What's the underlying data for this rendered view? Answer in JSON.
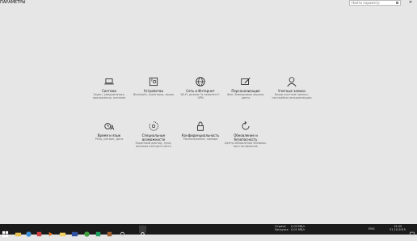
{
  "window": {
    "title": "Параметры",
    "close_glyph": "✕"
  },
  "search": {
    "placeholder": "Найти параметр"
  },
  "tiles": [
    {
      "icon": "laptop-icon",
      "name": "Система",
      "desc": "Экран, уведомления, приложения, питание"
    },
    {
      "icon": "devices-icon",
      "name": "Устройства",
      "desc": "Bluetooth, принтеры, мышь"
    },
    {
      "icon": "globe-icon",
      "name": "Сеть и Интернет",
      "desc": "Wi-Fi, режим \"в самолете\", VPN"
    },
    {
      "icon": "personalization-icon",
      "name": "Персонализация",
      "desc": "Фон, блокировка экрана, цвета"
    },
    {
      "icon": "user-icon",
      "name": "Учетные записи",
      "desc": "Ваши учетные записи, настройки синхронизации"
    },
    {
      "icon": "time-language-icon",
      "name": "Время и язык",
      "desc": "Речь, регион, дата"
    },
    {
      "icon": "accessibility-icon",
      "name": "Специальные возможности",
      "desc": "Экранный диктор, лупа, высокая контрастность"
    },
    {
      "icon": "lock-icon",
      "name": "Конфиденциальность",
      "desc": "Расположение, камера"
    },
    {
      "icon": "update-icon",
      "name": "Обновление и безопасность",
      "desc": "Центр обновления Windows, восстановление"
    }
  ],
  "taskbar": {
    "start_icon": "windows-logo-icon",
    "apps": [
      "file-explorer-icon",
      "browser-icon",
      "store-icon",
      "media-icon",
      "folder-icon",
      "terminal-icon",
      "chrome-icon",
      "game-icon",
      "photoshop-icon",
      "settings-icon"
    ],
    "tray": {
      "label1": "Отдача",
      "label2": "Загрузка",
      "speed1": "0,00 МБ/с",
      "speed2": "0,01 МБ/с",
      "lang": "ENG",
      "time": "13:40",
      "date": "21.10.2015"
    }
  },
  "colors": {
    "background": "#e6e6e6",
    "taskbar": "#1b1b1b",
    "accent": "#0078d7"
  }
}
